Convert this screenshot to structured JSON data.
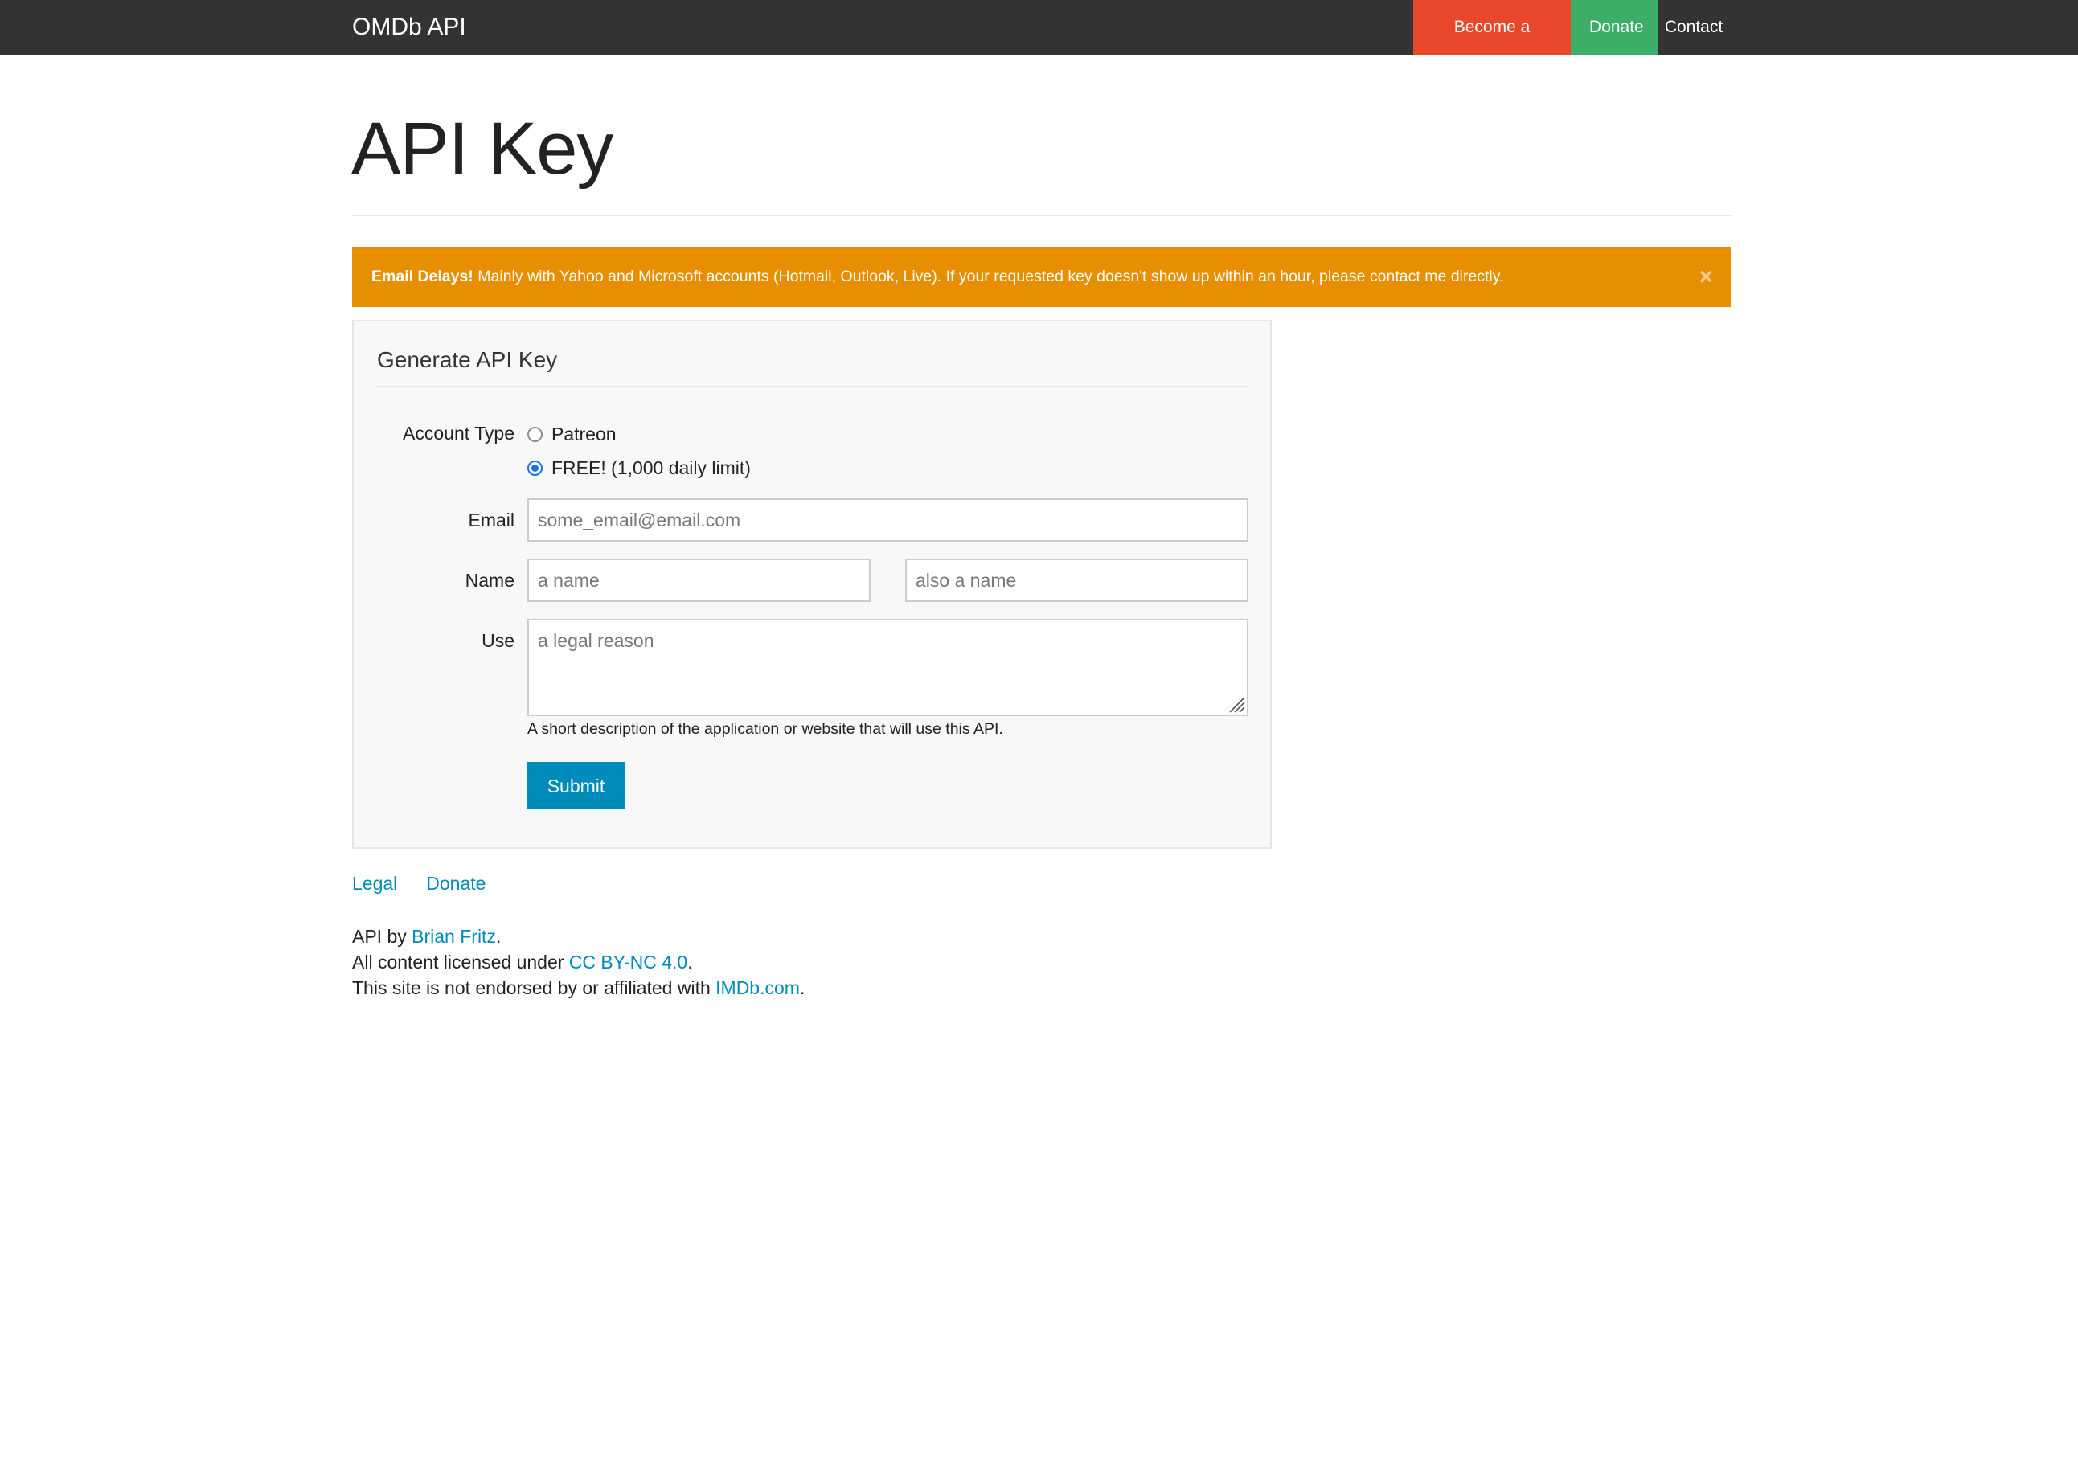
{
  "navbar": {
    "brand": "OMDb API",
    "items": [
      {
        "label": "Become a Patron",
        "color": "#e8472b"
      },
      {
        "label": "Donate",
        "color": "#3cae67"
      },
      {
        "label": "Contact"
      }
    ]
  },
  "page": {
    "title": "API Key"
  },
  "alert": {
    "strong": "Email Delays!",
    "message": " Mainly with Yahoo and Microsoft accounts (Hotmail, Outlook, Live). If your requested key doesn't show up within an hour, please contact me directly.",
    "close_glyph": "×",
    "color": "#e78f00"
  },
  "form": {
    "legend": "Generate API Key",
    "account_type": {
      "label": "Account Type",
      "options": [
        {
          "label": "Patreon",
          "checked": false
        },
        {
          "label": "FREE! (1,000 daily limit)",
          "checked": true
        }
      ]
    },
    "email": {
      "label": "Email",
      "placeholder": "some_email@email.com"
    },
    "name": {
      "label": "Name",
      "first_placeholder": "a name",
      "last_placeholder": "also a name"
    },
    "use": {
      "label": "Use",
      "placeholder": "a legal reason",
      "help": "A short description of the application or website that will use this API."
    },
    "submit_label": "Submit",
    "submit_color": "#008cba"
  },
  "footer": {
    "links": [
      "Legal",
      "Donate"
    ],
    "credit_prefix": "API by ",
    "credit_link": "Brian Fritz",
    "credit_suffix": ".",
    "license_prefix": "All content licensed under ",
    "license_link": "CC BY-NC 4.0",
    "license_suffix": ".",
    "disclaimer_prefix": "This site is not endorsed by or affiliated with ",
    "disclaimer_link": "IMDb.com",
    "disclaimer_suffix": "."
  }
}
